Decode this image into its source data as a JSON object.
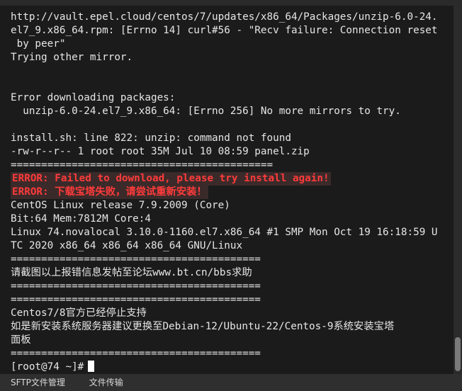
{
  "terminal": {
    "lines": [
      {
        "text": "http://vault.epel.cloud/centos/7/updates/x86_64/Packages/unzip-6.0-24.",
        "type": "normal"
      },
      {
        "text": "el7_9.x86_64.rpm: [Errno 14] curl#56 - \"Recv failure: Connection reset",
        "type": "normal"
      },
      {
        "text": " by peer\"",
        "type": "normal"
      },
      {
        "text": "Trying other mirror.",
        "type": "normal"
      },
      {
        "text": "",
        "type": "normal"
      },
      {
        "text": "",
        "type": "normal"
      },
      {
        "text": "Error downloading packages:",
        "type": "normal"
      },
      {
        "text": "  unzip-6.0-24.el7_9.x86_64: [Errno 256] No more mirrors to try.",
        "type": "normal"
      },
      {
        "text": "",
        "type": "normal"
      },
      {
        "text": "install.sh: line 822: unzip: command not found",
        "type": "normal"
      },
      {
        "text": "-rw-r--r-- 1 root root 35M Jul 10 08:59 panel.zip",
        "type": "normal"
      },
      {
        "text": "===========================================",
        "type": "normal"
      },
      {
        "text": "ERROR: Failed to download, please try install again!",
        "type": "error"
      },
      {
        "text": "ERROR: 下载宝塔失败，请尝试重新安装！",
        "type": "error"
      },
      {
        "text": "CentOS Linux release 7.9.2009 (Core)",
        "type": "normal"
      },
      {
        "text": "Bit:64 Mem:7812M Core:4",
        "type": "normal"
      },
      {
        "text": "Linux 74.novalocal 3.10.0-1160.el7.x86_64 #1 SMP Mon Oct 19 16:18:59 U",
        "type": "normal"
      },
      {
        "text": "TC 2020 x86_64 x86_64 x86_64 GNU/Linux",
        "type": "normal"
      },
      {
        "text": "=========================================",
        "type": "normal"
      },
      {
        "text": "请截图以上报错信息发帖至论坛www.bt.cn/bbs求助",
        "type": "normal"
      },
      {
        "text": "=========================================",
        "type": "normal"
      },
      {
        "text": "=========================================",
        "type": "normal"
      },
      {
        "text": "Centos7/8官方已经停止支持",
        "type": "normal"
      },
      {
        "text": "如是新安装系统服务器建议更换至Debian-12/Ubuntu-22/Centos-9系统安装宝塔",
        "type": "normal"
      },
      {
        "text": "面板",
        "type": "normal"
      },
      {
        "text": "=========================================",
        "type": "normal"
      }
    ],
    "prompt": "[root@74 ~]#"
  },
  "bottom_tabs": [
    "SFTP文件管理",
    "文件传输"
  ],
  "colors": {
    "background": "#1b1b1b",
    "text": "#e6e6e6",
    "error_text": "#ff3b3b",
    "error_bg": "#3b2a2a",
    "bottom_bar": "#2f2f2f"
  }
}
